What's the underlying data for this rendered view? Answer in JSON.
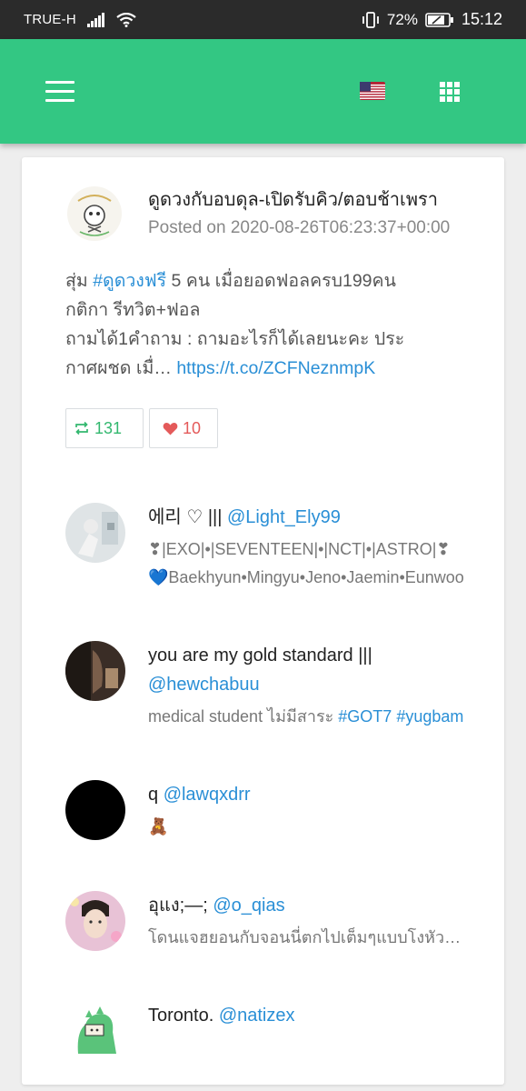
{
  "status_bar": {
    "carrier": "TRUE-H",
    "battery_percent": "72%",
    "time": "15:12"
  },
  "app_bar": {
    "menu_icon": "hamburger-menu-icon",
    "language_flag": "🇺🇸",
    "apps_icon": "grid-icon"
  },
  "post": {
    "title": "ดูดวงกับอบดุล-เปิดรับคิว/ตอบช้าเพรา",
    "posted_on": "Posted on 2020-08-26T06:23:37+00:00",
    "body_line1_pre": "สุ่ม ",
    "body_hashtag": "#ดูดวงฟรี",
    "body_line1_post": " 5 คน เมื่อยอดฟอลครบ199คน",
    "body_line2": "กติกา รีทวิต+ฟอล",
    "body_line3": "ถามได้1คำถาม : ถามอะไรก็ได้เลยนะคะ ประ",
    "body_line4": "กาศผชด เมื่… ",
    "body_link": "https://t.co/ZCFNeznmpK",
    "retweets": "131",
    "likes": "10",
    "colors": {
      "retweet": "#33b86f",
      "like": "#e45a5a",
      "link": "#2a8fd6",
      "header": "#33c783"
    }
  },
  "users": [
    {
      "name": "에리 ♡ ||| ",
      "handle": "@Light_Ely99",
      "bio1": "❣|EXO|•|SEVENTEEN|•|NCT|•|ASTRO|❣",
      "bio2": "💙Baekhyun•Mingyu•Jeno•Jaemin•Eunwoo"
    },
    {
      "name": "you are my gold standard |||",
      "handle": "@hewchabuu",
      "bio_pre": "medical student ไม่มีสาระ ",
      "bio_tags": "#GOT7 #yugbam"
    },
    {
      "name": "q ",
      "handle": "@lawqxdrr",
      "bio": "🧸"
    },
    {
      "name": "อุแง;—; ",
      "handle": "@o_qias",
      "bio": "โดนแจฮยอนกับจอนนี่ตกไปเต็มๆแบบโงหัวไม่ขึ้น"
    },
    {
      "name": "Toronto. ",
      "handle": "@natizex"
    }
  ]
}
